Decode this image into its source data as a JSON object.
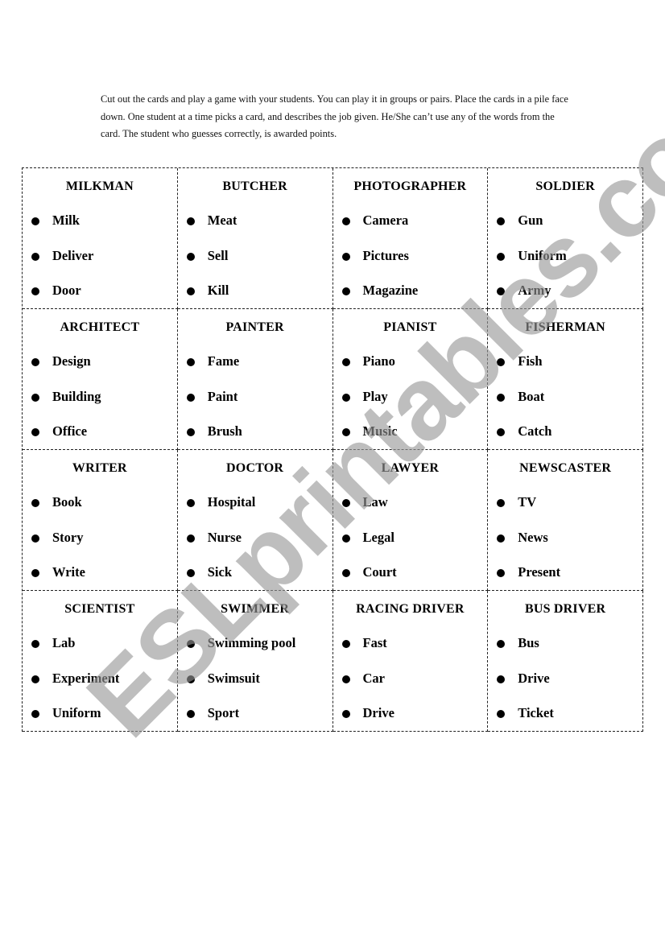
{
  "instructions": "Cut out the cards and play a game with your students. You can play it in groups or pairs. Place the cards in a pile face down. One student at a time picks a card, and describes the job given. He/She can’t use any of the words from the card. The student who guesses correctly, is awarded points.",
  "watermark": "ESLprintables.com",
  "cards": [
    {
      "title": "MILKMAN",
      "words": [
        "Milk",
        "Deliver",
        "Door"
      ]
    },
    {
      "title": "BUTCHER",
      "words": [
        "Meat",
        "Sell",
        "Kill"
      ]
    },
    {
      "title": "PHOTOGRAPHER",
      "words": [
        "Camera",
        "Pictures",
        "Magazine"
      ]
    },
    {
      "title": "SOLDIER",
      "words": [
        "Gun",
        "Uniform",
        "Army"
      ]
    },
    {
      "title": "ARCHITECT",
      "words": [
        "Design",
        "Building",
        "Office"
      ]
    },
    {
      "title": "PAINTER",
      "words": [
        "Fame",
        "Paint",
        "Brush"
      ]
    },
    {
      "title": "PIANIST",
      "words": [
        "Piano",
        "Play",
        "Music"
      ]
    },
    {
      "title": "FISHERMAN",
      "words": [
        "Fish",
        "Boat",
        "Catch"
      ]
    },
    {
      "title": "WRITER",
      "words": [
        "Book",
        "Story",
        "Write"
      ]
    },
    {
      "title": "DOCTOR",
      "words": [
        "Hospital",
        "Nurse",
        "Sick"
      ]
    },
    {
      "title": "LAWYER",
      "words": [
        "Law",
        "Legal",
        "Court"
      ]
    },
    {
      "title": "NEWSCASTER",
      "words": [
        "TV",
        "News",
        "Present"
      ]
    },
    {
      "title": "SCIENTIST",
      "words": [
        "Lab",
        "Experiment",
        "Uniform"
      ]
    },
    {
      "title": "SWIMMER",
      "words": [
        "Swimming pool",
        "Swimsuit",
        "Sport"
      ]
    },
    {
      "title": "RACING DRIVER",
      "words": [
        "Fast",
        "Car",
        "Drive"
      ]
    },
    {
      "title": "BUS DRIVER",
      "words": [
        "Bus",
        "Drive",
        "Ticket"
      ]
    }
  ]
}
